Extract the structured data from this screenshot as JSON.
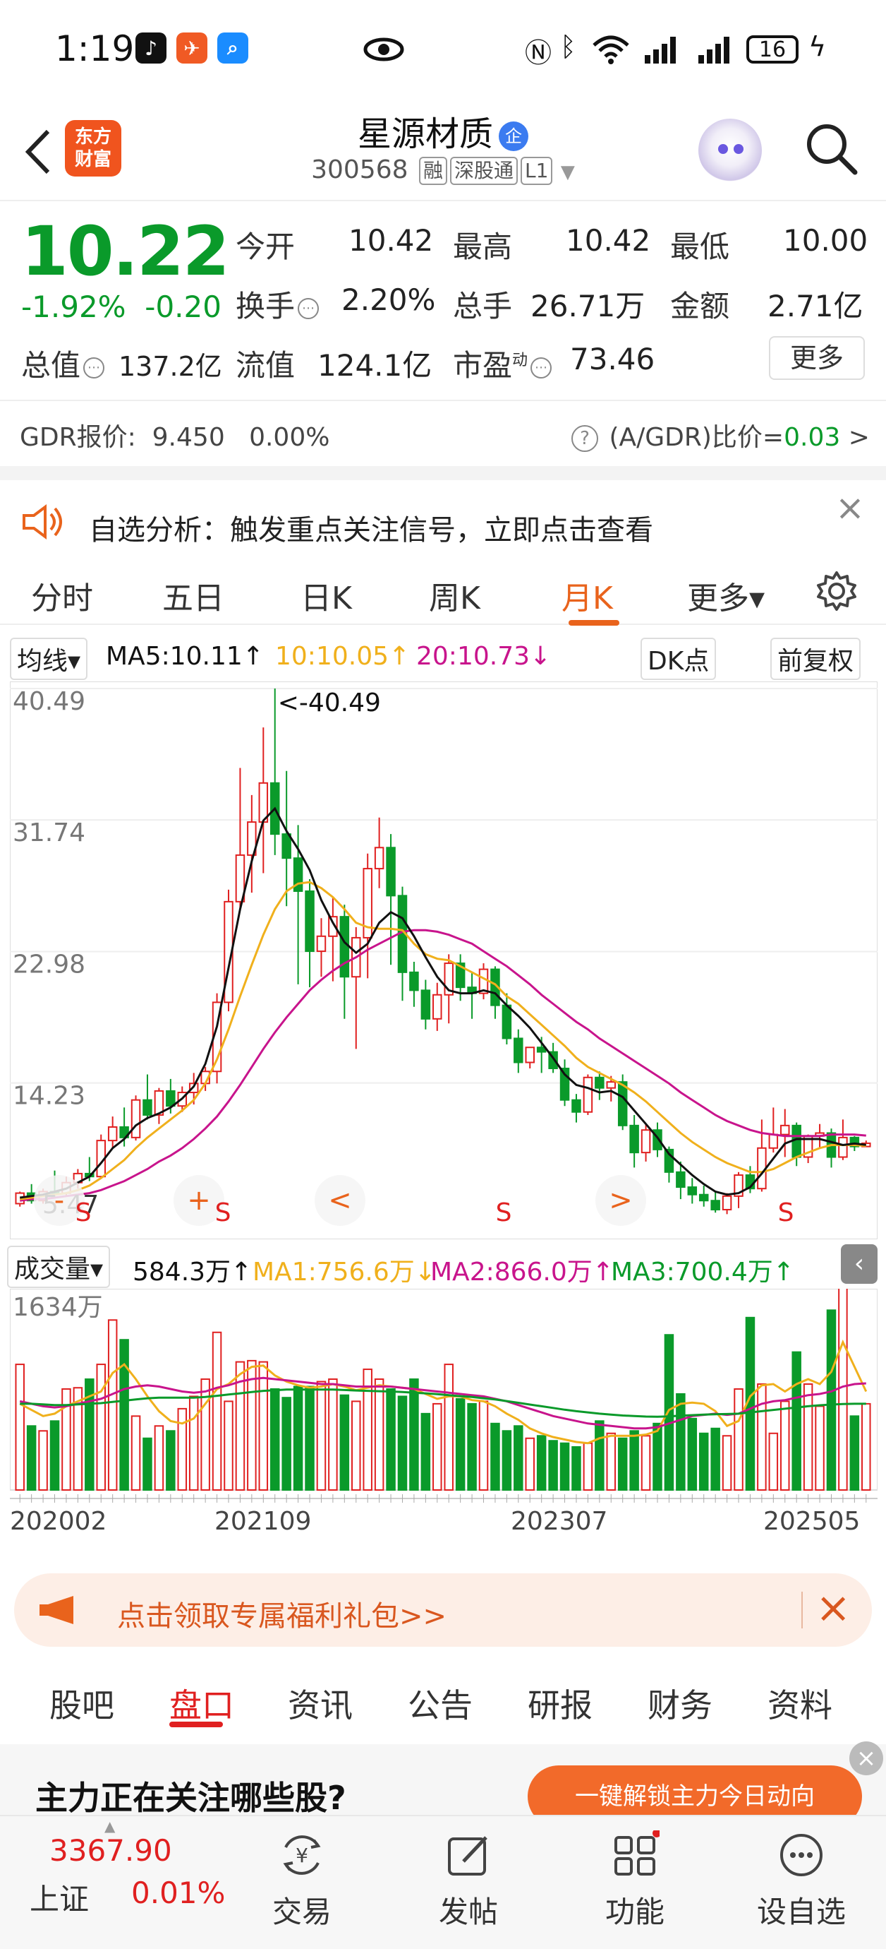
{
  "status_bar": {
    "time": "1:19",
    "battery": "16"
  },
  "header": {
    "logo_line1": "东方",
    "logo_line2": "财富",
    "title": "星源材质",
    "title_badge": "企",
    "code": "300568",
    "tags": [
      "融",
      "深股通",
      "L1"
    ]
  },
  "quote": {
    "price": "10.22",
    "change_pct": "-1.92%",
    "change": "-0.20",
    "open_label": "今开",
    "open": "10.42",
    "high_label": "最高",
    "high": "10.42",
    "low_label": "最低",
    "low": "10.00",
    "turnover_label": "换手",
    "turnover": "2.20%",
    "volume_label": "总手",
    "volume": "26.71万",
    "amount_label": "金额",
    "amount": "2.71亿",
    "mktcap_label": "总值",
    "mktcap": "137.2亿",
    "float_label": "流值",
    "float_cap": "124.1亿",
    "pe_label": "市盈",
    "pe_sup": "动",
    "pe": "73.46",
    "more_label": "更多"
  },
  "gdr": {
    "label": "GDR报价:",
    "price": "9.450",
    "pct": "0.00%",
    "ratio_label": "(A/GDR)比价=",
    "ratio": "0.03",
    "arrow": ">"
  },
  "analysis": {
    "text": "自选分析：触发重点关注信号，立即点击查看"
  },
  "chart_tabs": {
    "items": [
      "分时",
      "五日",
      "日K",
      "周K",
      "月K",
      "更多▾"
    ],
    "active": "月K"
  },
  "ma_bar": {
    "indicator": "均线▾",
    "ma5": "MA5:10.11↑",
    "ma10": "10:10.05↑",
    "ma20": "20:10.73↓",
    "dk": "DK点",
    "adjust": "前复权"
  },
  "colors": {
    "up": "#e02020",
    "down": "#0a9a2a",
    "ma5": "#111111",
    "ma10": "#f0b01c",
    "ma20": "#c8148c",
    "accent": "#e9631c"
  },
  "chart_data": [
    {
      "type": "candlestick",
      "title": "月K",
      "y_ticks": [
        "40.49",
        "31.74",
        "22.98",
        "14.23"
      ],
      "high_annotation": "<-40.49",
      "low_annotation": "5.47",
      "ylim": [
        5.47,
        40.49
      ],
      "series_names": [
        "MA5",
        "MA10",
        "MA20"
      ],
      "candles": [
        [
          6.2,
          7.0,
          6.9,
          6.0
        ],
        [
          6.9,
          7.5,
          6.4,
          6.2
        ],
        [
          6.4,
          7.2,
          7.0,
          6.2
        ],
        [
          7.0,
          8.4,
          6.9,
          6.6
        ],
        [
          6.9,
          8.0,
          7.6,
          6.7
        ],
        [
          7.6,
          8.5,
          8.2,
          7.2
        ],
        [
          8.2,
          9.3,
          8.0,
          7.7
        ],
        [
          8.0,
          10.8,
          10.4,
          7.9
        ],
        [
          10.4,
          12.0,
          11.3,
          9.9
        ],
        [
          11.3,
          12.6,
          10.6,
          10.0
        ],
        [
          10.6,
          13.4,
          13.1,
          10.4
        ],
        [
          13.1,
          14.8,
          12.1,
          11.8
        ],
        [
          12.1,
          13.9,
          13.7,
          11.5
        ],
        [
          13.7,
          14.5,
          12.7,
          12.2
        ],
        [
          12.7,
          14.0,
          13.6,
          12.3
        ],
        [
          13.6,
          14.9,
          14.2,
          12.8
        ],
        [
          14.2,
          15.3,
          15.0,
          13.7
        ],
        [
          15.0,
          20.2,
          19.6,
          14.2
        ],
        [
          19.6,
          27.1,
          26.3,
          19.0
        ],
        [
          26.3,
          35.2,
          29.4,
          25.7
        ],
        [
          29.4,
          33.4,
          31.6,
          26.9
        ],
        [
          31.6,
          37.9,
          34.2,
          28.2
        ],
        [
          34.2,
          40.49,
          30.8,
          29.4
        ],
        [
          30.8,
          35.0,
          29.2,
          26.0
        ],
        [
          29.2,
          31.4,
          27.0,
          20.8
        ],
        [
          27.0,
          27.8,
          23.0,
          20.6
        ],
        [
          23.0,
          25.2,
          24.0,
          21.3
        ],
        [
          24.0,
          26.6,
          25.3,
          21.0
        ],
        [
          25.3,
          26.1,
          21.3,
          18.5
        ],
        [
          21.3,
          24.6,
          23.9,
          16.5
        ],
        [
          23.9,
          29.5,
          28.5,
          21.2
        ],
        [
          28.5,
          31.9,
          29.9,
          27.2
        ],
        [
          29.9,
          30.8,
          26.7,
          22.1
        ],
        [
          26.7,
          27.3,
          21.6,
          19.7
        ],
        [
          21.6,
          22.3,
          20.4,
          19.3
        ],
        [
          20.4,
          21.1,
          18.5,
          17.8
        ],
        [
          18.5,
          20.9,
          20.1,
          17.7
        ],
        [
          20.1,
          22.8,
          22.2,
          18.2
        ],
        [
          22.2,
          22.8,
          20.6,
          19.7
        ],
        [
          20.6,
          21.6,
          20.2,
          18.5
        ],
        [
          20.2,
          22.2,
          21.8,
          19.8
        ],
        [
          21.8,
          22.0,
          19.4,
          18.5
        ],
        [
          19.4,
          20.2,
          17.2,
          16.8
        ],
        [
          17.2,
          17.8,
          15.6,
          14.9
        ],
        [
          15.6,
          16.5,
          16.6,
          15.2
        ],
        [
          16.6,
          17.3,
          16.3,
          14.9
        ],
        [
          16.3,
          16.9,
          15.2,
          14.9
        ],
        [
          15.2,
          15.8,
          13.1,
          12.7
        ],
        [
          13.1,
          13.5,
          12.3,
          11.6
        ],
        [
          12.3,
          14.8,
          14.6,
          12.1
        ],
        [
          14.6,
          15.0,
          13.9,
          13.1
        ],
        [
          13.9,
          14.7,
          14.3,
          13.0
        ],
        [
          14.3,
          14.8,
          11.4,
          11.1
        ],
        [
          11.4,
          12.1,
          9.6,
          8.6
        ],
        [
          9.6,
          11.5,
          11.1,
          9.0
        ],
        [
          11.1,
          11.6,
          9.8,
          9.3
        ],
        [
          9.8,
          10.0,
          8.3,
          7.6
        ],
        [
          8.3,
          9.0,
          7.3,
          6.5
        ],
        [
          7.3,
          7.9,
          6.8,
          6.2
        ],
        [
          6.8,
          7.4,
          6.4,
          6.0
        ],
        [
          6.4,
          7.0,
          5.8,
          5.6
        ],
        [
          5.8,
          6.9,
          6.7,
          5.5
        ],
        [
          6.7,
          8.3,
          8.1,
          5.9
        ],
        [
          8.1,
          8.7,
          7.2,
          6.9
        ],
        [
          7.2,
          11.8,
          9.9,
          7.0
        ],
        [
          9.9,
          12.6,
          10.8,
          9.6
        ],
        [
          10.8,
          12.5,
          11.4,
          9.3
        ],
        [
          11.4,
          11.6,
          9.3,
          8.7
        ],
        [
          9.3,
          10.8,
          10.7,
          8.9
        ],
        [
          10.7,
          11.5,
          10.9,
          9.9
        ],
        [
          10.9,
          11.2,
          9.3,
          8.6
        ],
        [
          9.3,
          11.8,
          10.6,
          9.1
        ],
        [
          10.6,
          10.7,
          10.0,
          9.7
        ],
        [
          10.0,
          10.4,
          10.22,
          10.0
        ]
      ],
      "ma5": [
        6.6,
        6.7,
        6.8,
        7.0,
        7.2,
        7.6,
        8.0,
        8.9,
        9.9,
        10.5,
        11.4,
        11.9,
        12.2,
        12.6,
        13.2,
        14.0,
        15.5,
        18.0,
        21.9,
        25.8,
        29.0,
        31.7,
        32.5,
        31.0,
        29.8,
        28.4,
        26.4,
        24.9,
        23.6,
        22.9,
        23.5,
        24.9,
        25.6,
        25.2,
        24.0,
        22.6,
        21.3,
        20.4,
        20.2,
        20.2,
        20.4,
        20.2,
        19.4,
        18.7,
        17.9,
        16.9,
        15.9,
        14.8,
        14.1,
        13.9,
        13.6,
        13.7,
        13.3,
        12.4,
        11.5,
        10.6,
        9.5,
        8.8,
        8.1,
        7.5,
        7.0,
        6.8,
        6.9,
        7.3,
        8.2,
        9.2,
        10.2,
        10.5,
        10.5,
        10.5,
        10.3,
        10.1,
        10.2,
        10.11
      ],
      "ma10": [
        6.5,
        6.6,
        6.7,
        6.8,
        6.9,
        7.1,
        7.4,
        7.9,
        8.5,
        9.1,
        9.9,
        10.6,
        11.2,
        11.8,
        12.4,
        13.1,
        14.2,
        15.8,
        17.8,
        20.0,
        22.1,
        24.1,
        25.8,
        27.0,
        27.5,
        27.6,
        27.2,
        26.6,
        25.8,
        24.9,
        24.6,
        24.5,
        24.5,
        24.4,
        23.5,
        22.8,
        22.5,
        22.4,
        22.0,
        21.6,
        21.2,
        20.8,
        20.0,
        19.5,
        18.8,
        18.1,
        17.4,
        16.7,
        15.9,
        15.3,
        14.9,
        14.5,
        14.1,
        13.6,
        13.0,
        12.3,
        11.6,
        10.9,
        10.3,
        9.8,
        9.3,
        8.9,
        8.6,
        8.3,
        8.3,
        8.5,
        8.9,
        9.3,
        9.6,
        9.9,
        10.1,
        10.1,
        10.1,
        10.05
      ],
      "ma20": [
        6.4,
        6.5,
        6.5,
        6.6,
        6.7,
        6.8,
        6.9,
        7.1,
        7.4,
        7.7,
        8.1,
        8.5,
        9.0,
        9.4,
        9.9,
        10.5,
        11.2,
        12.0,
        13.0,
        14.1,
        15.3,
        16.5,
        17.6,
        18.6,
        19.5,
        20.4,
        21.1,
        21.7,
        22.2,
        22.6,
        23.1,
        23.5,
        23.9,
        24.3,
        24.4,
        24.4,
        24.3,
        24.1,
        23.8,
        23.5,
        23.0,
        22.5,
        22.0,
        21.4,
        20.8,
        20.1,
        19.5,
        18.9,
        18.3,
        17.8,
        17.2,
        16.7,
        16.2,
        15.7,
        15.2,
        14.7,
        14.2,
        13.6,
        13.1,
        12.6,
        12.1,
        11.7,
        11.4,
        11.1,
        10.9,
        10.8,
        10.7,
        10.7,
        10.7,
        10.7,
        10.8,
        10.8,
        10.8,
        10.73
      ],
      "markers": [
        {
          "label": "-",
          "sub": "S"
        },
        {
          "label": "+",
          "sub": "S"
        },
        {
          "label": "<",
          "sub": ""
        },
        {
          "label": "",
          "sub": "S"
        },
        {
          "label": ">",
          "sub": ""
        },
        {
          "label": "",
          "sub": "S"
        }
      ]
    },
    {
      "type": "bar",
      "title": "成交量",
      "y_ticks": [
        "1634万"
      ],
      "ylim": [
        0,
        1634
      ],
      "x_labels": [
        "202002",
        "202109",
        "202307",
        "202505"
      ],
      "series_names": [
        "MA1",
        "MA2",
        "MA3"
      ],
      "volume": [
        1020,
        520,
        480,
        560,
        820,
        830,
        900,
        1020,
        1380,
        1220,
        600,
        420,
        520,
        480,
        660,
        760,
        900,
        1280,
        720,
        1040,
        1050,
        1040,
        820,
        750,
        840,
        840,
        880,
        900,
        770,
        720,
        980,
        900,
        820,
        760,
        900,
        620,
        700,
        1020,
        740,
        700,
        720,
        540,
        480,
        520,
        420,
        440,
        400,
        380,
        350,
        380,
        560,
        460,
        420,
        480,
        440,
        540,
        1260,
        780,
        580,
        460,
        500,
        440,
        820,
        1400,
        860,
        460,
        720,
        1120,
        860,
        680,
        1460,
        1780,
        600,
        700
      ],
      "volume_ma": [
        [
          700,
          650,
          600,
          620,
          680,
          720,
          760,
          800,
          950,
          1020,
          900,
          760,
          640,
          560,
          540,
          580,
          700,
          820,
          860,
          940,
          1000,
          1010,
          930,
          880,
          850,
          830,
          840,
          860,
          840,
          810,
          830,
          850,
          840,
          830,
          820,
          780,
          740,
          760,
          760,
          730,
          720,
          680,
          620,
          570,
          500,
          460,
          430,
          410,
          390,
          380,
          420,
          440,
          440,
          440,
          450,
          480,
          650,
          700,
          710,
          700,
          640,
          520,
          560,
          760,
          850,
          860,
          800,
          860,
          900,
          860,
          960,
          1200,
          1000,
          800
        ],
        [
          720,
          700,
          680,
          670,
          680,
          700,
          720,
          740,
          780,
          820,
          840,
          850,
          840,
          820,
          800,
          790,
          800,
          830,
          850,
          880,
          900,
          910,
          900,
          890,
          880,
          870,
          860,
          860,
          850,
          840,
          840,
          840,
          840,
          830,
          820,
          810,
          800,
          790,
          780,
          770,
          760,
          740,
          720,
          690,
          660,
          630,
          600,
          580,
          560,
          540,
          530,
          520,
          510,
          500,
          500,
          510,
          540,
          570,
          600,
          610,
          620,
          610,
          620,
          660,
          700,
          720,
          730,
          750,
          770,
          780,
          800,
          840,
          860,
          866
        ],
        [
          700,
          700,
          695,
          690,
          690,
          695,
          700,
          705,
          715,
          725,
          735,
          745,
          750,
          750,
          750,
          750,
          755,
          765,
          775,
          785,
          795,
          805,
          810,
          815,
          815,
          815,
          815,
          815,
          812,
          808,
          805,
          802,
          800,
          795,
          790,
          785,
          778,
          770,
          762,
          755,
          745,
          735,
          722,
          708,
          694,
          680,
          666,
          652,
          640,
          630,
          620,
          612,
          605,
          600,
          596,
          595,
          598,
          603,
          608,
          612,
          615,
          617,
          620,
          630,
          640,
          650,
          660,
          670,
          680,
          688,
          694,
          698,
          700,
          700
        ]
      ]
    }
  ],
  "volume_bar": {
    "indicator": "成交量▾",
    "vol": "584.3万↑",
    "ma1": "MA1:756.6万↓",
    "ma2": "MA2:866.0万↑",
    "ma3": "MA3:700.4万↑"
  },
  "promo": {
    "text": "点击领取专属福利礼包>>"
  },
  "bottom_tabs": {
    "items": [
      "股吧",
      "盘口",
      "资讯",
      "公告",
      "研报",
      "财务",
      "资料"
    ],
    "active": "盘口"
  },
  "strip": {
    "text": "主力正在关注哪些股?",
    "button": "一键解锁主力今日动向"
  },
  "bottom_nav": {
    "index_value": "3367.90",
    "index_name": "上证",
    "index_pct": "0.01%",
    "items": [
      "交易",
      "发帖",
      "功能",
      "设自选"
    ]
  }
}
